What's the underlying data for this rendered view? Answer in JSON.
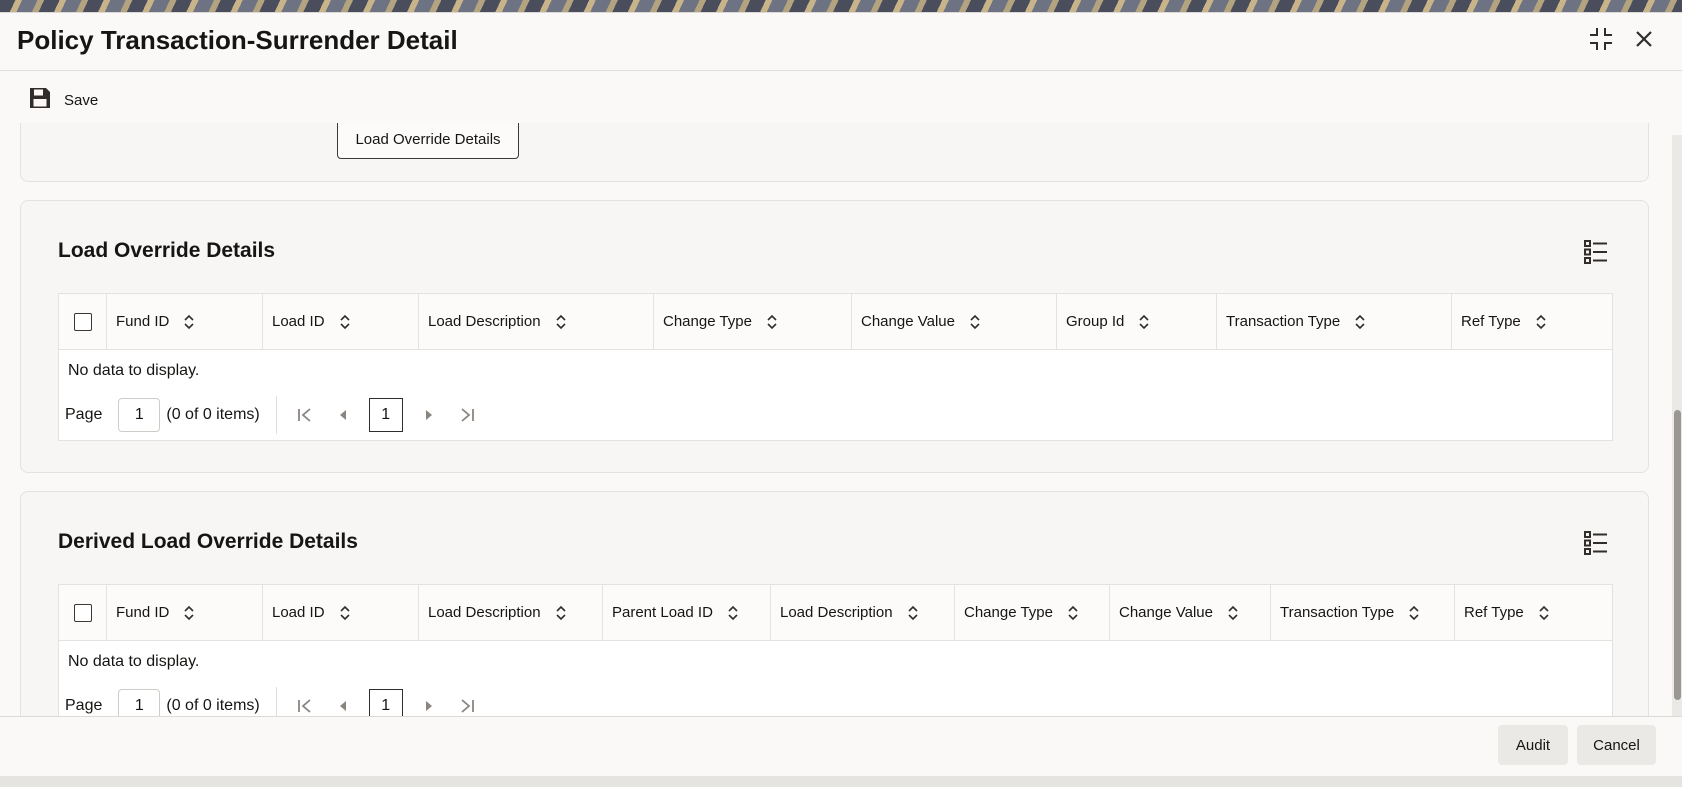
{
  "window": {
    "title": "Policy Transaction-Surrender Detail"
  },
  "toolbar": {
    "save_label": "Save"
  },
  "top_panel": {
    "button_label": "Load Override Details"
  },
  "load_override": {
    "title": "Load Override Details",
    "columns": [
      "Fund ID",
      "Load ID",
      "Load Description",
      "Change Type",
      "Change Value",
      "Group Id",
      "Transaction Type",
      "Ref Type"
    ],
    "empty_text": "No data to display.",
    "pager": {
      "page_label": "Page",
      "page_value": "1",
      "items_text": "(0 of 0 items)",
      "current_page": "1"
    }
  },
  "derived_load_override": {
    "title": "Derived Load Override Details",
    "columns": [
      "Fund ID",
      "Load ID",
      "Load Description",
      "Parent Load ID",
      "Load Description",
      "Change Type",
      "Change Value",
      "Transaction Type",
      "Ref Type"
    ],
    "empty_text": "No data to display.",
    "pager": {
      "page_label": "Page",
      "page_value": "1",
      "items_text": "(0 of 0 items)",
      "current_page": "1"
    }
  },
  "footer": {
    "audit_label": "Audit",
    "cancel_label": "Cancel"
  },
  "icons": {
    "save": "floppy-disk-icon",
    "maximize": "maximize-icon",
    "close": "close-icon",
    "column_list": "column-list-icon",
    "sort": "sort-icon"
  }
}
